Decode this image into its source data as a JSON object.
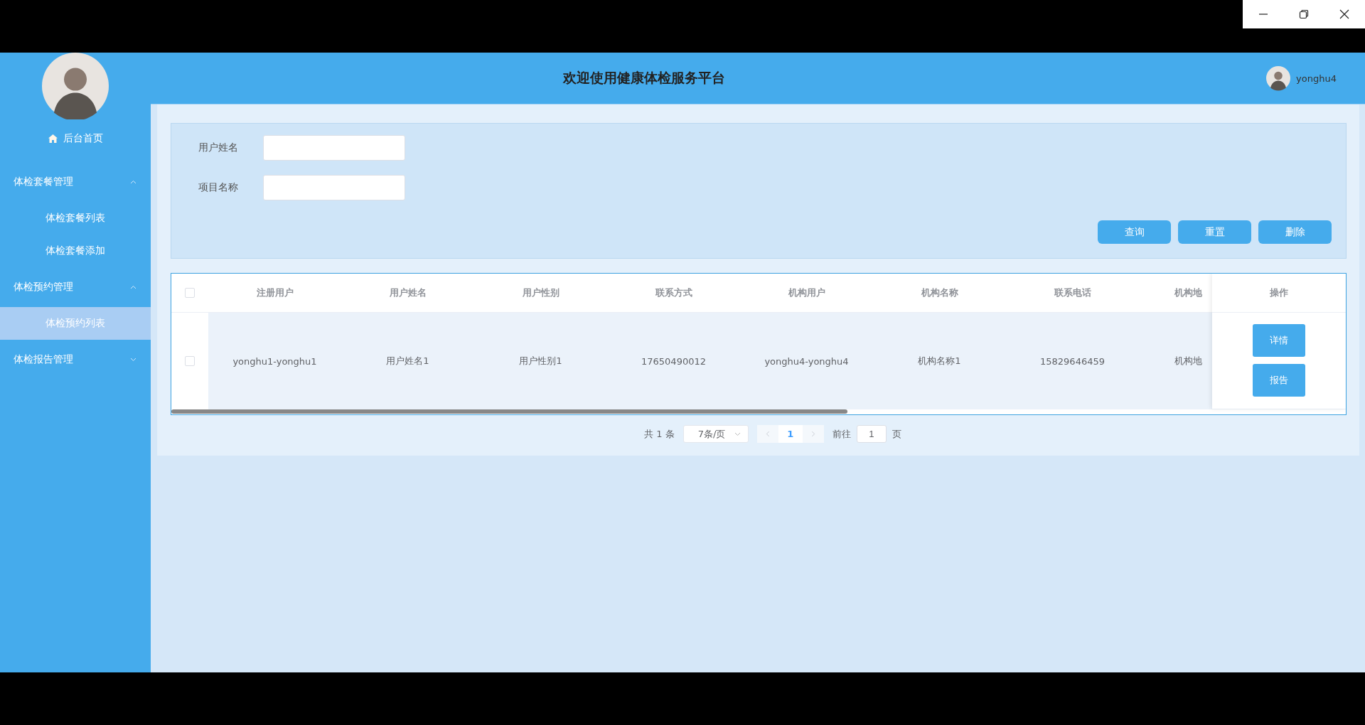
{
  "header": {
    "title": "欢迎使用健康体检服务平台",
    "user": "yonghu4"
  },
  "sidebar": {
    "home": "后台首页",
    "menus": [
      {
        "label": "体检套餐管理",
        "expanded": true,
        "children": [
          {
            "label": "体检套餐列表",
            "selected": false
          },
          {
            "label": "体检套餐添加",
            "selected": false
          }
        ]
      },
      {
        "label": "体检预约管理",
        "expanded": true,
        "children": [
          {
            "label": "体检预约列表",
            "selected": true
          }
        ]
      },
      {
        "label": "体检报告管理",
        "expanded": false
      }
    ]
  },
  "search": {
    "fields": [
      {
        "label": "用户姓名"
      },
      {
        "label": "项目名称"
      }
    ],
    "buttons": [
      "查询",
      "重置",
      "删除"
    ]
  },
  "table": {
    "all_checked": false,
    "columns": [
      "注册用户",
      "用户姓名",
      "用户性别",
      "联系方式",
      "机构用户",
      "机构名称",
      "联系电话",
      "机构地"
    ],
    "action_column": "操作",
    "rows": [
      {
        "checked": false,
        "cells": [
          "yonghu1-yonghu1",
          "用户姓名1",
          "用户性别1",
          "17650490012",
          "yonghu4-yonghu4",
          "机构名称1",
          "15829646459",
          "机构地"
        ],
        "actions": [
          "详情",
          "报告"
        ]
      }
    ]
  },
  "pagination": {
    "total": "共 1 条",
    "page_size": "7条/页",
    "pages": [
      {
        "label": "1",
        "selected": true
      }
    ],
    "goto_label": "前往",
    "goto_value": "1",
    "page_suffix": "页"
  }
}
